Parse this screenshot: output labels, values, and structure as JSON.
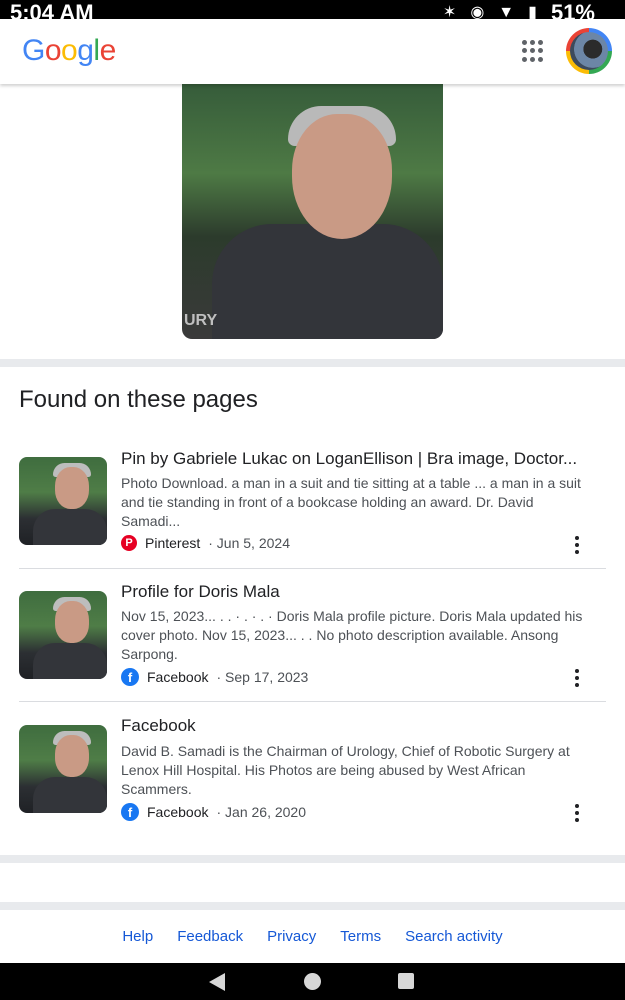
{
  "status_bar": {
    "time": "5:04 AM",
    "battery": "51%"
  },
  "header": {
    "logo_letters": [
      {
        "ch": "G",
        "color": "#4285F4"
      },
      {
        "ch": "o",
        "color": "#EA4335"
      },
      {
        "ch": "o",
        "color": "#FBBC05"
      },
      {
        "ch": "g",
        "color": "#4285F4"
      },
      {
        "ch": "l",
        "color": "#34A853"
      },
      {
        "ch": "e",
        "color": "#EA4335"
      }
    ]
  },
  "section_title": "Found on these pages",
  "results": [
    {
      "title": "Pin by Gabriele Lukac on LoganEllison | Bra image, Doctor...",
      "snippet": "Photo Download. a man in a suit and tie sitting at a table ... a man in a suit and tie standing in front of a bookcase holding an award. Dr. David Samadi...",
      "source": "Pinterest",
      "date": "· Jun 5, 2024",
      "source_icon": "pinterest-icon"
    },
    {
      "title": "Profile for Doris Mala",
      "snippet": "Nov 15, 2023... . . · . · . · Doris Mala profile picture. Doris Mala updated his cover photo. Nov 15, 2023... . . No photo description available. Ansong Sarpong.",
      "source": "Facebook",
      "date": "· Sep 17, 2023",
      "source_icon": "facebook-icon"
    },
    {
      "title": "Facebook",
      "snippet": "David B. Samadi is the Chairman of Urology, Chief of Robotic Surgery at Lenox Hill Hospital. His Photos are being abused by West African Scammers.",
      "source": "Facebook",
      "date": "· Jan 26, 2020",
      "source_icon": "facebook-icon"
    }
  ],
  "hero_watermark": "URY",
  "footer": {
    "help": "Help",
    "feedback": "Feedback",
    "privacy": "Privacy",
    "terms": "Terms",
    "search_activity": "Search activity"
  }
}
